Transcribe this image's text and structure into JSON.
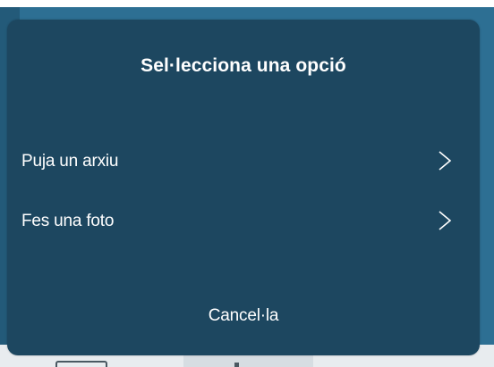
{
  "dialog": {
    "title": "Sel·lecciona una opció",
    "options": [
      {
        "label": "Puja un arxiu",
        "icon": "chevron-right-icon"
      },
      {
        "label": "Fes una foto",
        "icon": "chevron-right-icon"
      }
    ],
    "cancel_label": "Cancel·la"
  },
  "colors": {
    "sheet_background": "#1d4760",
    "app_background": "#2d6f93",
    "text": "#ffffff"
  }
}
